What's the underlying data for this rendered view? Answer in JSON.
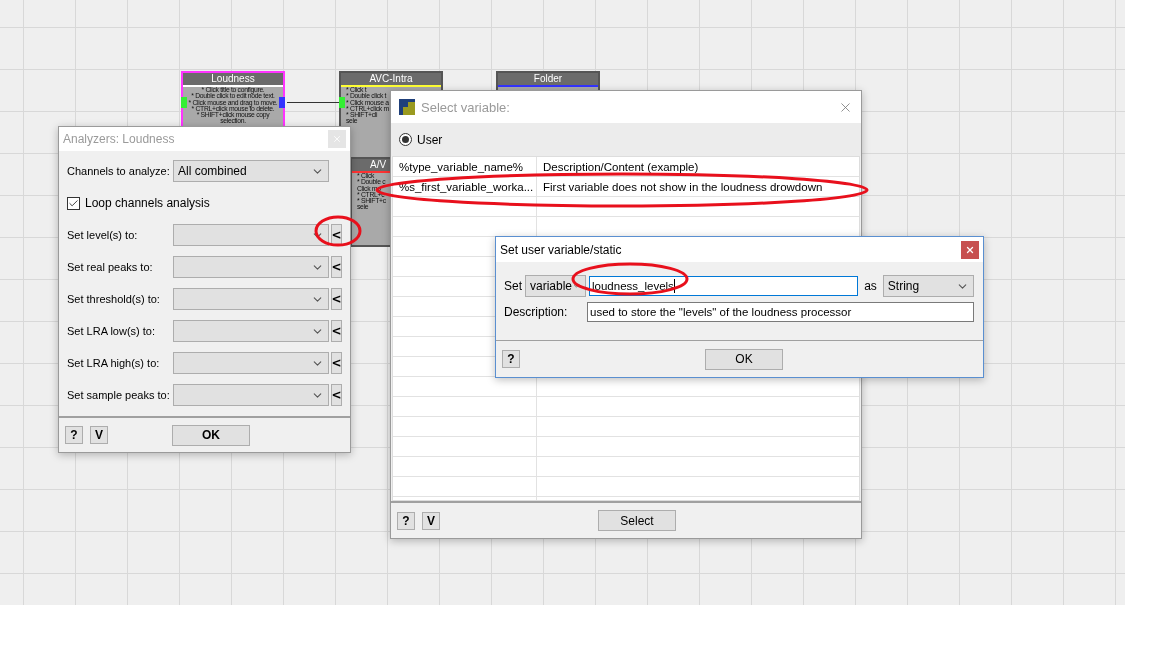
{
  "nodes": [
    {
      "title": "Loudness",
      "color": "#ffffff",
      "selected": true,
      "lines": [
        "* Click title to configure.",
        "* Double click to edit node text.",
        "* Click mouse and drag to move.",
        "* CTRL+click mouse to delete.",
        "* SHIFT+click mouse copy",
        "selection."
      ]
    },
    {
      "title": "AVC-Intra",
      "color": "#ffff33",
      "selected": false,
      "lines": [
        "* Click t",
        "* Double click t",
        "* Click mouse a",
        "* CTRL+click m",
        "* SHIFT+cli",
        "sele"
      ]
    },
    {
      "title": "Folder",
      "color": "#3333ff",
      "selected": false
    },
    {
      "title": "A/V",
      "color": "#ff3333",
      "selected": false,
      "lines": [
        "* Click",
        "* Double c",
        "Click mo",
        "* CTRL+c",
        "* SHIFT+c",
        "sele"
      ]
    }
  ],
  "loudness_dialog": {
    "title": "Analyzers: Loudness",
    "channels_label": "Channels to analyze:",
    "channels_value": "All combined",
    "loop": {
      "label": "Loop channels analysis",
      "checked": true
    },
    "rows": [
      {
        "label": "Set level(s) to:",
        "button": "<"
      },
      {
        "label": "Set real peaks to:",
        "button": "<"
      },
      {
        "label": "Set threshold(s) to:",
        "button": "<"
      },
      {
        "label": "Set LRA low(s) to:",
        "button": "<"
      },
      {
        "label": "Set LRA high(s) to:",
        "button": "<"
      },
      {
        "label": "Set sample peaks to:",
        "button": "<"
      }
    ],
    "footer_buttons": [
      "?",
      "V"
    ],
    "ok": "OK"
  },
  "select_dialog": {
    "title": "Select variable:",
    "radio": {
      "label": "User",
      "selected": true
    },
    "rows": [
      {
        "name": "%type_variable_name%",
        "description": "Description/Content (example)"
      },
      {
        "name": "%s_first_variable_worka...",
        "description": "First variable does not show in the loudness drowdown"
      }
    ],
    "footer_buttons": [
      "?",
      "V"
    ],
    "select": "Select"
  },
  "user_variable_dialog": {
    "title": "Set user variable/static",
    "set_label": "Set",
    "kind_value": "variable",
    "name_value": "loudness_levels",
    "as_label": "as",
    "type_value": "String",
    "description_label": "Description:",
    "description_value": "used to store the \"levels\" of the loudness processor",
    "help": "?",
    "ok": "OK"
  }
}
